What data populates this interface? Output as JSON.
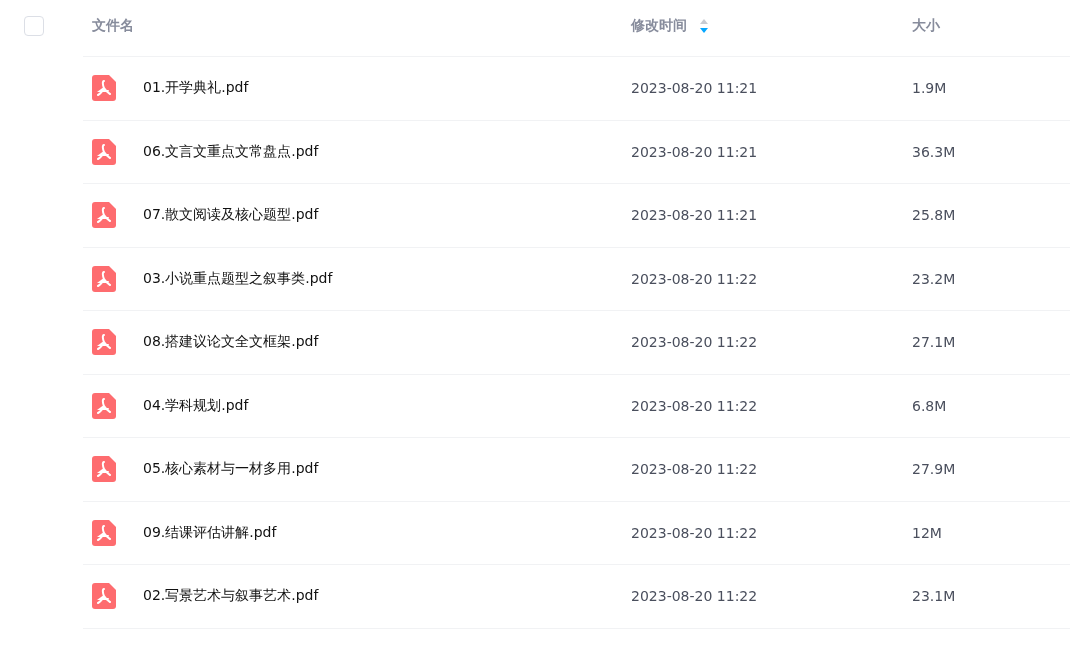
{
  "header": {
    "select_all": {
      "checked": false
    },
    "columns": [
      {
        "label": "文件名"
      },
      {
        "label": "修改时间",
        "sorted_descending": true
      },
      {
        "label": "大小"
      }
    ]
  },
  "rows": [
    {
      "name": "01.开学典礼.pdf",
      "modified": "2023-08-20 11:21",
      "size": "1.9M"
    },
    {
      "name": "06.文言文重点文常盘点.pdf",
      "modified": "2023-08-20 11:21",
      "size": "36.3M"
    },
    {
      "name": "07.散文阅读及核心题型.pdf",
      "modified": "2023-08-20 11:21",
      "size": "25.8M"
    },
    {
      "name": "03.小说重点题型之叙事类.pdf",
      "modified": "2023-08-20 11:22",
      "size": "23.2M"
    },
    {
      "name": "08.搭建议论文全文框架.pdf",
      "modified": "2023-08-20 11:22",
      "size": "27.1M"
    },
    {
      "name": "04.学科规划.pdf",
      "modified": "2023-08-20 11:22",
      "size": "6.8M"
    },
    {
      "name": "05.核心素材与一材多用.pdf",
      "modified": "2023-08-20 11:22",
      "size": "27.9M"
    },
    {
      "name": "09.结课评估讲解.pdf",
      "modified": "2023-08-20 11:22",
      "size": "12M"
    },
    {
      "name": "02.写景艺术与叙事艺术.pdf",
      "modified": "2023-08-20 11:22",
      "size": "23.1M"
    }
  ]
}
